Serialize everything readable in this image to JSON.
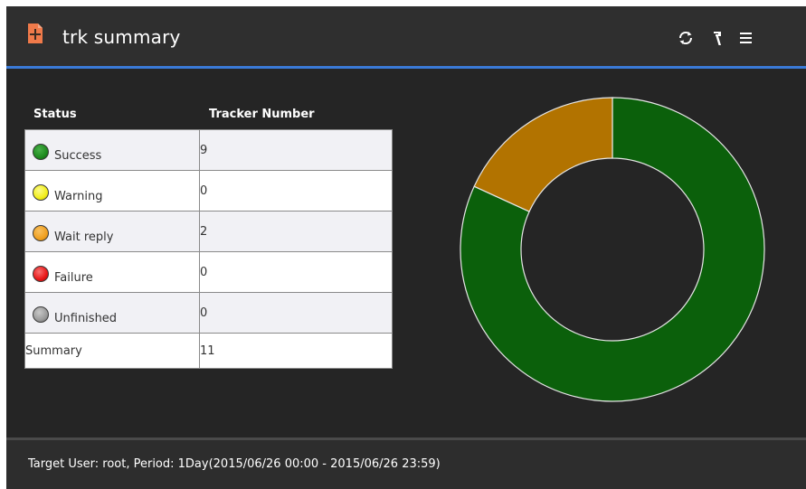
{
  "header": {
    "title": "trk summary",
    "icons": [
      "document-icon",
      "refresh-icon",
      "wrench-icon",
      "menu-icon"
    ],
    "accent_color": "#3a7ad8"
  },
  "table": {
    "columns": [
      "Status",
      "Tracker Number"
    ],
    "rows": [
      {
        "status": "Success",
        "count": "9",
        "color": "#1f8a1f",
        "icon": "green-status-icon"
      },
      {
        "status": "Warning",
        "count": "0",
        "color": "#f2ee1a",
        "icon": "yellow-status-icon"
      },
      {
        "status": "Wait reply",
        "count": "2",
        "color": "#f0a020",
        "icon": "orange-status-icon"
      },
      {
        "status": "Failure",
        "count": "0",
        "color": "#e81616",
        "icon": "red-status-icon"
      },
      {
        "status": "Unfinished",
        "count": "0",
        "color": "#9a9a9a",
        "icon": "gray-status-icon"
      }
    ],
    "summary": {
      "label": "Summary",
      "count": "11"
    }
  },
  "chart_data": {
    "type": "pie",
    "title": "",
    "slices": [
      {
        "label": "Success",
        "value": 9,
        "color": "#0b600b"
      },
      {
        "label": "Wait reply",
        "value": 2,
        "color": "#b27300"
      }
    ],
    "donut": true
  },
  "footer": {
    "text": "Target User: root, Period: 1Day(2015/06/26 00:00 - 2015/06/26 23:59)"
  }
}
